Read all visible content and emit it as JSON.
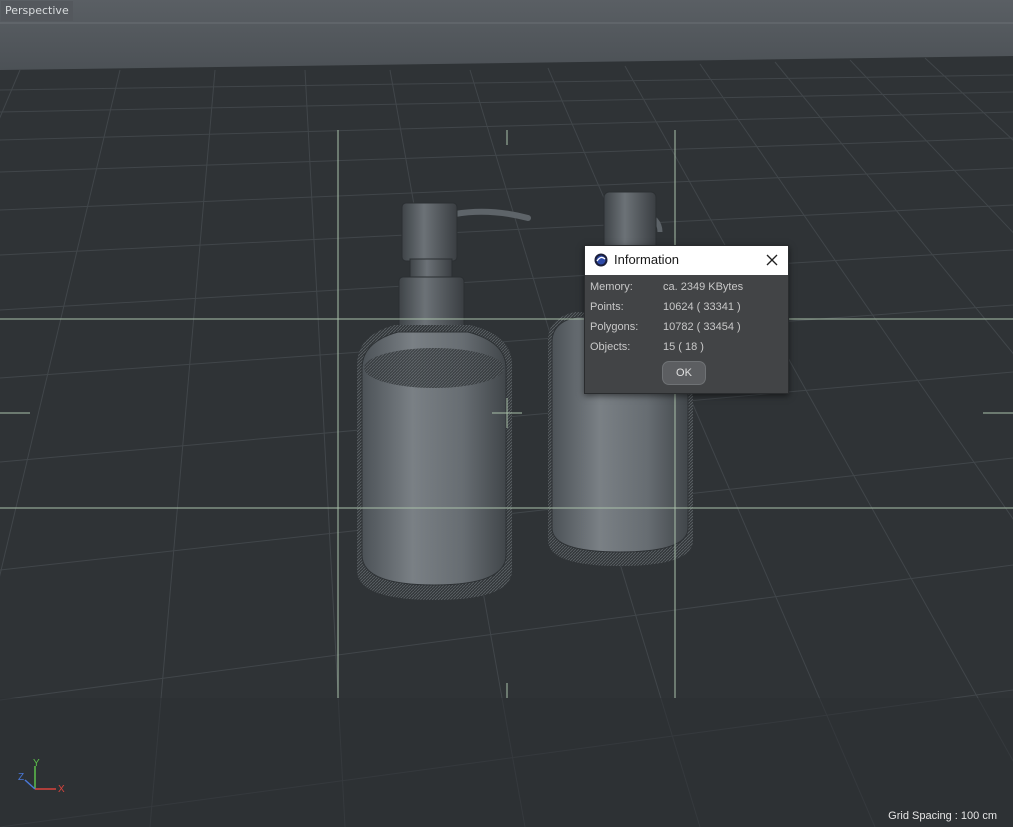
{
  "viewport": {
    "label": "Perspective",
    "grid_spacing": "Grid Spacing : 100 cm",
    "axis_labels": {
      "x": "X",
      "y": "Y",
      "z": "Z"
    }
  },
  "dialog": {
    "title": "Information",
    "icon": "cinema4d-logo-icon",
    "close_icon": "close-icon",
    "rows": [
      {
        "label": "Memory:",
        "value": "ca. 2349 KBytes"
      },
      {
        "label": "Points:",
        "value": "10624 ( 33341 )"
      },
      {
        "label": "Polygons:",
        "value": "10782 ( 33454 )"
      },
      {
        "label": "Objects:",
        "value": "15 ( 18 )"
      }
    ],
    "ok_label": "OK"
  },
  "colors": {
    "viewport_bg": "#2f3336",
    "grid_line": "#454a4e",
    "safe_frame": "#a9c0a9",
    "axis_x": "#d9433d",
    "axis_y": "#5dc14b",
    "axis_z": "#4a78d8"
  }
}
